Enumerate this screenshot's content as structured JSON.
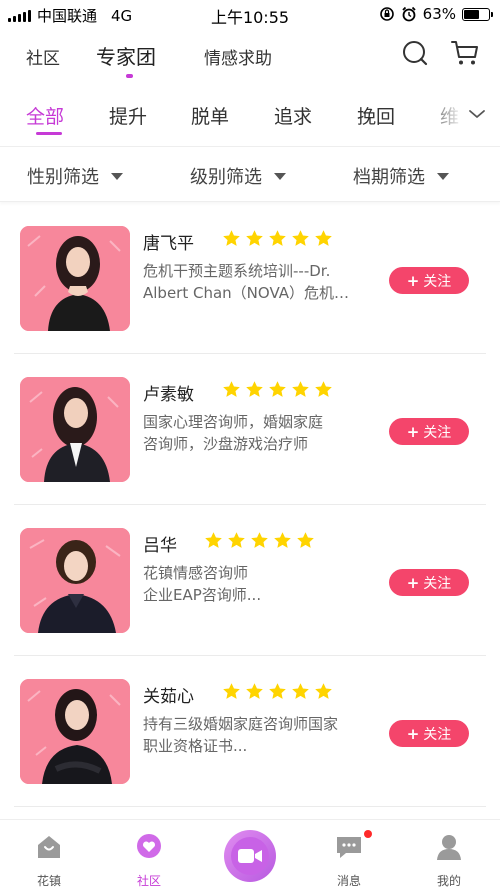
{
  "status_bar": {
    "carrier": "中国联通",
    "network": "4G",
    "time": "上午10:55",
    "battery": "63%",
    "battery_level": 0.63
  },
  "top_nav": {
    "tabs": [
      {
        "label": "社区"
      },
      {
        "label": "专家团",
        "active": true
      },
      {
        "label": "情感求助"
      }
    ],
    "icons": [
      "search-icon",
      "cart-icon"
    ]
  },
  "categories": {
    "items": [
      "全部",
      "提升",
      "脱单",
      "追求",
      "挽回",
      "维"
    ],
    "active_index": 0
  },
  "filters": [
    "性别筛选",
    "级别筛选",
    "档期筛选"
  ],
  "experts": [
    {
      "name": "唐飞平",
      "rating": 5,
      "desc_line1": "危机干预主题系统培训---Dr.",
      "desc_line2": "Albert Chan（NOVA）危机…",
      "follow_label": "关注"
    },
    {
      "name": "卢素敏",
      "rating": 5,
      "desc_line1": "国家心理咨询师，婚姻家庭",
      "desc_line2": "咨询师，沙盘游戏治疗师",
      "follow_label": "关注"
    },
    {
      "name": "吕华",
      "rating": 5,
      "desc_line1": "花镇情感咨询师",
      "desc_line2": "企业EAP咨询师...",
      "follow_label": "关注"
    },
    {
      "name": "关茹心",
      "rating": 5,
      "desc_line1": "持有三级婚姻家庭咨询师国家",
      "desc_line2": "职业资格证书...",
      "follow_label": "关注"
    }
  ],
  "bottom_nav": {
    "items": [
      {
        "label": "花镇",
        "icon": "home-icon"
      },
      {
        "label": "社区",
        "icon": "heart-bubble-icon",
        "active": true
      },
      {
        "label": "",
        "icon": "video-camera-icon"
      },
      {
        "label": "消息",
        "icon": "message-icon",
        "badge": true
      },
      {
        "label": "我的",
        "icon": "profile-icon"
      }
    ]
  },
  "colors": {
    "accent": "#c63ad6",
    "follow_button": "#f4456b",
    "star": "#ffd400",
    "photo_bg": "#f7879b"
  }
}
